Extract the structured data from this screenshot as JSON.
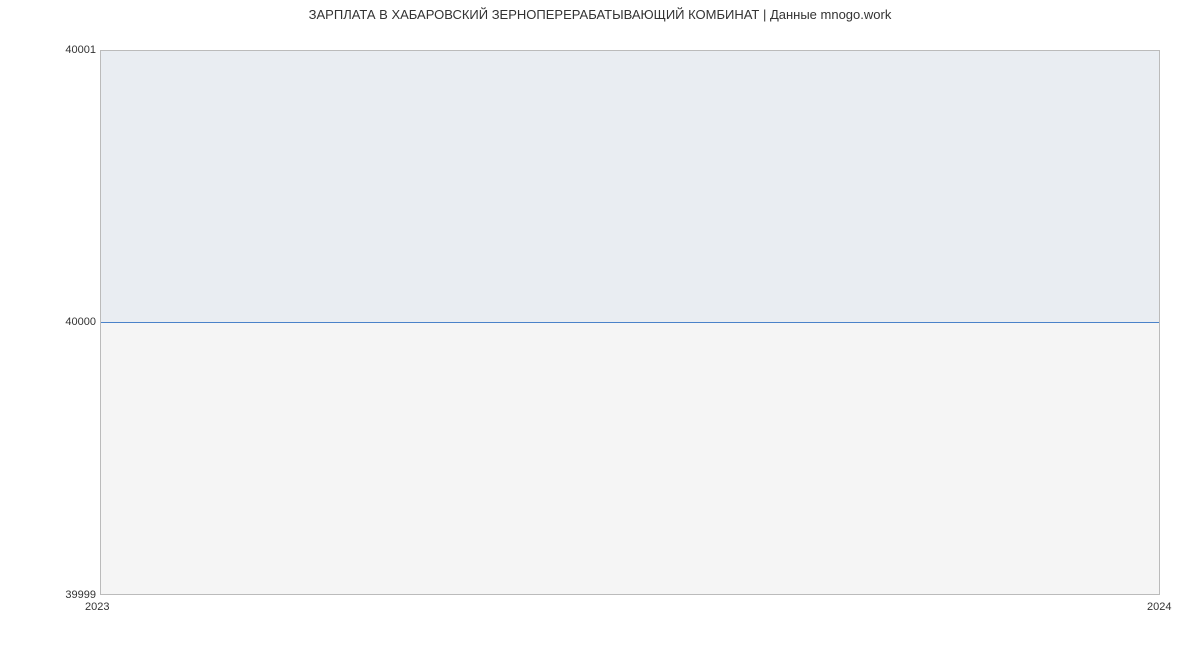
{
  "title": "ЗАРПЛАТА В  ХАБАРОВСКИЙ ЗЕРНОПЕРЕРАБАТЫВАЮЩИЙ КОМБИНАТ | Данные mnogo.work",
  "y_ticks": {
    "top": "40001",
    "mid": "40000",
    "bottom": "39999"
  },
  "x_ticks": {
    "left": "2023",
    "right": "2024"
  },
  "chart_data": {
    "type": "area",
    "title": "ЗАРПЛАТА В  ХАБАРОВСКИЙ ЗЕРНОПЕРЕРАБАТЫВАЮЩИЙ КОМБИНАТ | Данные mnogo.work",
    "xlabel": "",
    "ylabel": "",
    "x": [
      2023,
      2024
    ],
    "values": [
      40000,
      40000
    ],
    "ylim": [
      39999,
      40001
    ],
    "xlim": [
      2023,
      2024
    ]
  }
}
